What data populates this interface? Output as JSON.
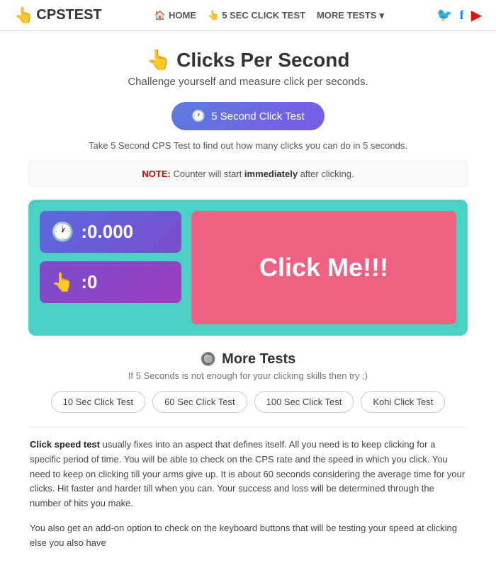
{
  "navbar": {
    "brand": "CPSTEST",
    "brand_icon": "👆",
    "nav": {
      "home_label": "HOME",
      "home_icon": "🏠",
      "sec_click_label": "5 SEC CLICK TEST",
      "sec_icon": "👆",
      "more_tests_label": "MORE TESTS",
      "dropdown_icon": "▾"
    },
    "social": {
      "twitter_icon": "🐦",
      "facebook_icon": "f",
      "youtube_icon": "▶"
    }
  },
  "hero": {
    "title_icon": "👆",
    "title": "Clicks Per Second",
    "subtitle": "Challenge yourself and measure click per seconds.",
    "btn_label": "5 Second Click Test",
    "btn_icon": "🕐",
    "desc": "Take 5 Second CPS Test to find out how many clicks you can do in 5 seconds.",
    "note_label": "NOTE:",
    "note_text": " Counter will start ",
    "note_bold": "immediately",
    "note_end": " after clicking."
  },
  "click_area": {
    "time_icon": "🕐",
    "time_value": "0.000",
    "click_icon": "👆",
    "click_value": "0",
    "click_me_label": "Click Me!!!"
  },
  "more_tests": {
    "section_icon": "🔘",
    "title": "More Tests",
    "subtitle": "If 5 Seconds is not enough for your clicking skills then try ;)",
    "buttons": [
      "10 Sec Click Test",
      "60 Sec Click Test",
      "100 Sec Click Test",
      "Kohi Click Test"
    ]
  },
  "article": {
    "para1_bold": "Click speed test",
    "para1_rest": " usually fixes into an aspect that defines itself. All you need is to keep clicking for a specific period of time. You will be able to check on the CPS rate and the speed in which you click. You need to keep on clicking till your arms give up. It is about 60 seconds considering the average time for your clicks. Hit faster and harder till when you can. Your success and loss will be determined through the number of hits you make.",
    "para2": "You also get an add-on option to check on the keyboard buttons that will be testing your speed at clicking else you also have"
  }
}
